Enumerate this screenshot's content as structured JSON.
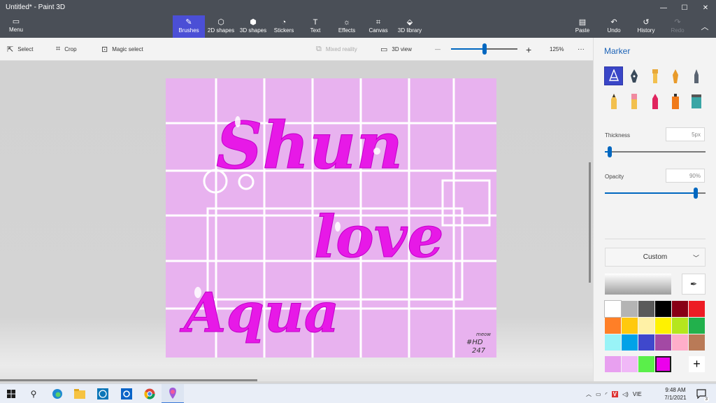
{
  "window": {
    "title": "Untitled* - Paint 3D",
    "controls": {
      "minimize": "—",
      "maximize": "☐",
      "close": "✕"
    }
  },
  "ribbon": {
    "menu_label": "Menu",
    "items": [
      {
        "label": "Brushes",
        "icon": "brush-icon"
      },
      {
        "label": "2D shapes",
        "icon": "2d-shapes-icon"
      },
      {
        "label": "3D shapes",
        "icon": "3d-shapes-icon"
      },
      {
        "label": "Stickers",
        "icon": "stickers-icon"
      },
      {
        "label": "Text",
        "icon": "text-icon"
      },
      {
        "label": "Effects",
        "icon": "effects-icon"
      },
      {
        "label": "Canvas",
        "icon": "canvas-icon"
      },
      {
        "label": "3D library",
        "icon": "3d-library-icon"
      }
    ],
    "right_items": [
      {
        "label": "Paste",
        "icon": "paste-icon"
      },
      {
        "label": "Undo",
        "icon": "undo-icon"
      },
      {
        "label": "History",
        "icon": "history-icon"
      },
      {
        "label": "Redo",
        "icon": "redo-icon"
      }
    ],
    "active": "Brushes"
  },
  "toolbar": {
    "select": "Select",
    "crop": "Crop",
    "magic_select": "Magic select",
    "mixed_reality": "Mixed reality",
    "view_3d": "3D view",
    "zoom_out": "—",
    "zoom_in": "+",
    "zoom": "125%",
    "zoom_level": 0.5,
    "more": "···"
  },
  "canvas": {
    "background": "#e8b2ef",
    "texts": [
      "Shun",
      "love",
      "Aqua"
    ],
    "signature": [
      "meow",
      "#HD",
      "247"
    ]
  },
  "panel": {
    "title": "Marker",
    "tools": [
      "marker-icon",
      "calligraphy-pen-icon",
      "oil-brush-icon",
      "watercolor-icon",
      "pixel-pen-icon",
      "pencil-icon",
      "eraser-icon",
      "crayon-icon",
      "spray-can-icon",
      "fill-icon"
    ],
    "thickness_label": "Thickness",
    "thickness_value": "5px",
    "thickness_level": 0.05,
    "opacity_label": "Opacity",
    "opacity_value": "90%",
    "opacity_level": 0.9,
    "color_mode": "Custom",
    "palette": [
      "#ffffff",
      "#b4b4b4",
      "#5a5a5a",
      "#000000",
      "#880015",
      "#ed1c24",
      "#ff7f27",
      "#ffc90e",
      "#fff1a6",
      "#fff200",
      "#b5e61d",
      "#22b14c",
      "#99f3f7",
      "#00a2e8",
      "#3f48cc",
      "#a349a4",
      "#ffaec9",
      "#b97a57"
    ],
    "custom_colors": [
      "#e8a0f0",
      "#f0b8f7",
      "#5aef4a",
      "#ec00ec"
    ],
    "selected_color": "#ec00ec",
    "add_color": "+"
  },
  "taskbar": {
    "apps": [
      "windows-icon",
      "search-icon",
      "edge-icon",
      "file-explorer-icon",
      "dell-icon",
      "outlook-icon",
      "chrome-icon",
      "paint3d-icon"
    ],
    "lang": "VIE",
    "time": "9:48 AM",
    "date": "7/1/2021",
    "notifications": "3"
  }
}
